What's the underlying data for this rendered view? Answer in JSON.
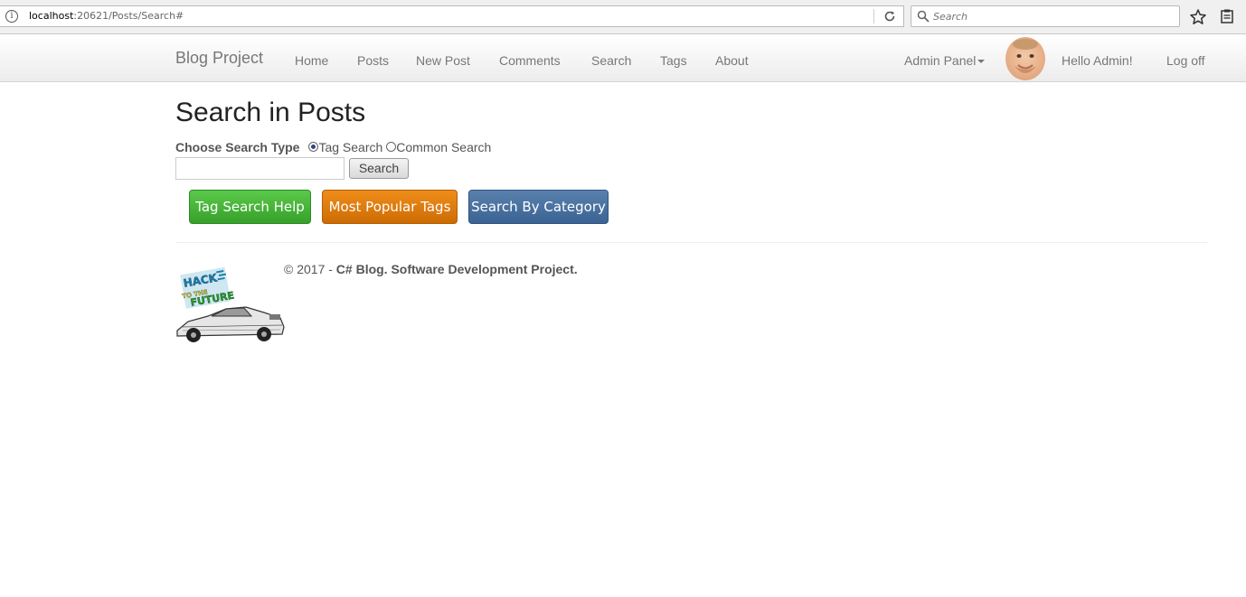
{
  "browser": {
    "url_host": "localhost",
    "url_rest": ":20621/Posts/Search#",
    "search_placeholder": "Search"
  },
  "navbar": {
    "brand": "Blog Project",
    "links": [
      "Home",
      "Posts",
      "New Post",
      "Comments",
      "Search",
      "Tags",
      "About"
    ],
    "admin_panel": "Admin Panel",
    "greeting": "Hello Admin!",
    "logoff": "Log off"
  },
  "main": {
    "title": "Search in Posts",
    "choose_label": "Choose Search Type",
    "radio_tag": "Tag Search",
    "radio_common": "Common Search",
    "selected_type": "Tag Search",
    "search_value": "",
    "search_button": "Search",
    "buttons": {
      "tag_help": "Tag Search Help",
      "popular_tags": "Most Popular Tags",
      "by_category": "Search By Category"
    }
  },
  "footer": {
    "copyright": "© 2017 - ",
    "project": "C# Blog. Software Development Project.",
    "logo_text": "HACK TO THE FUTURE"
  },
  "colors": {
    "green": "#3fae32",
    "orange": "#e07a0c",
    "blue": "#4a72a0"
  }
}
